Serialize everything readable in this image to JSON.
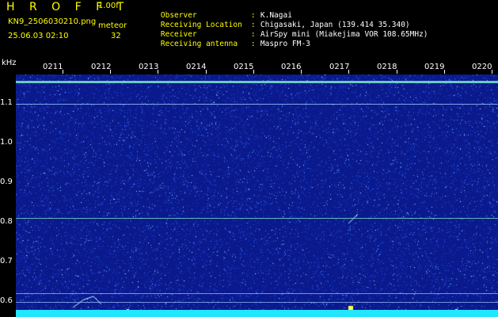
{
  "header": {
    "app_title": "H R O F F T",
    "version": "1.00f",
    "filename": "KN9_2506030210.png",
    "mode": "meteor",
    "datetime": "25.06.03 02:10",
    "count": "32",
    "meta": [
      {
        "key": "Observer",
        "value": "K.Nagai"
      },
      {
        "key": "Receiving Location",
        "value": "Chigasaki, Japan (139.414 35.340)"
      },
      {
        "key": "Receiver",
        "value": "AirSpy mini (Miakejima VOR 108.65MHz)"
      },
      {
        "key": "Receiving antenna",
        "value": "Maspro FM-3"
      }
    ]
  },
  "axes": {
    "y_unit": "kHz",
    "y_ticks": [
      "1.1",
      "1.0",
      "0.9",
      "0.8",
      "0.7",
      "0.6"
    ],
    "x_ticks": [
      "0211",
      "0212",
      "0213",
      "0214",
      "0215",
      "0216",
      "0217",
      "0218",
      "0219",
      "0220"
    ]
  },
  "colors": {
    "background": "#000000",
    "text_yellow": "#ffff00",
    "text_white": "#ffffff",
    "waterfall_base": "#0a1a8c",
    "noise_baseline": "#22e6ff"
  }
}
